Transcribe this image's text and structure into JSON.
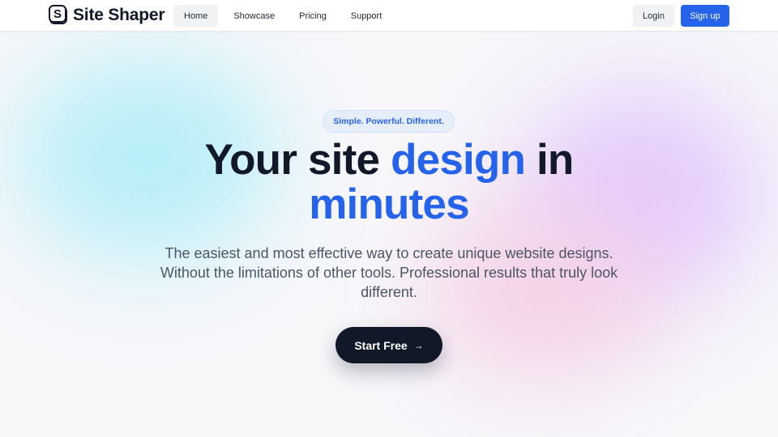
{
  "brand": {
    "name": "Site Shaper",
    "logo_letter": "S"
  },
  "nav": {
    "items": [
      {
        "label": "Home",
        "active": true
      },
      {
        "label": "Showcase",
        "active": false
      },
      {
        "label": "Pricing",
        "active": false
      },
      {
        "label": "Support",
        "active": false
      }
    ]
  },
  "auth": {
    "login_label": "Login",
    "signup_label": "Sign up"
  },
  "hero": {
    "badge": "Simple. Powerful. Different.",
    "title_part1": "Your site ",
    "title_highlight1": "design",
    "title_part2": " in",
    "title_highlight2": "minutes",
    "subtitle": "The easiest and most effective way to create unique website designs. Without the limitations of other tools. Professional results that truly look different.",
    "cta_label": "Start Free",
    "cta_icon": "arrow-right-icon"
  },
  "colors": {
    "accent": "#2563eb",
    "dark": "#111827",
    "badge_bg": "#e7eefb"
  }
}
